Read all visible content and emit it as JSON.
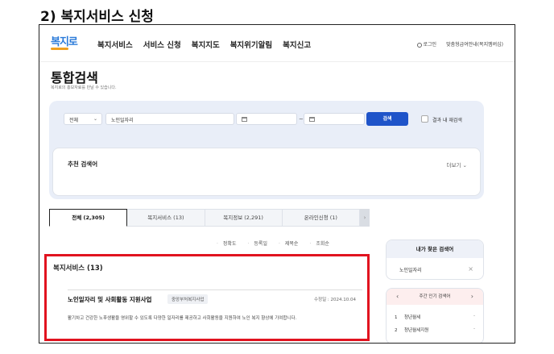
{
  "doc_heading": "2) 복지서비스 신청",
  "header": {
    "logo": "복지로",
    "nav": [
      "복지서비스",
      "서비스 신청",
      "복지지도",
      "복지위기알림",
      "복지신고"
    ],
    "login": "로그인",
    "accessibility": "맞춤형급여안내(복지멤버십)"
  },
  "page": {
    "title": "통합검색",
    "subtitle": "복지로의 홍보자료를 만날 수 있습니다."
  },
  "search": {
    "category": "전체",
    "keyword": "노인일자리",
    "date_separator": "~",
    "search_button": "검색",
    "within_results": "결과 내 재검색"
  },
  "recommend": {
    "title": "추천 검색어",
    "more": "더보기"
  },
  "tabs": [
    {
      "label": "전체 (2,305)",
      "active": true
    },
    {
      "label": "복지서비스 (13)",
      "active": false
    },
    {
      "label": "복지정보 (2,291)",
      "active": false
    },
    {
      "label": "온라인신청 (1)",
      "active": false
    }
  ],
  "sort_options": [
    "정확도",
    "등록일",
    "제목순",
    "조회순"
  ],
  "result_section": {
    "title": "복지서비스 (13)",
    "item": {
      "title": "노인일자리 및 사회활동 지원사업",
      "badge": "중앙부처복지사업",
      "date": "수정일 : 2024.10.04",
      "description": "활기차고 건강한 노후생활을 영위할 수 있도록 다양한 일자리를 제공하고 사회활동을 지원하여 노인 복지 향상에 기여합니다."
    }
  },
  "sidebar": {
    "my_searches_title": "내가 찾은 검색어",
    "my_search_item": "노인일자리",
    "popular_title": "주간 인기 검색어",
    "popular_items": [
      {
        "rank": "1",
        "label": "청년월세"
      },
      {
        "rank": "2",
        "label": "청년월세지원"
      }
    ]
  },
  "colors": {
    "primary": "#1f54c9",
    "highlight": "#e1131f",
    "panel": "#e9eef8"
  }
}
